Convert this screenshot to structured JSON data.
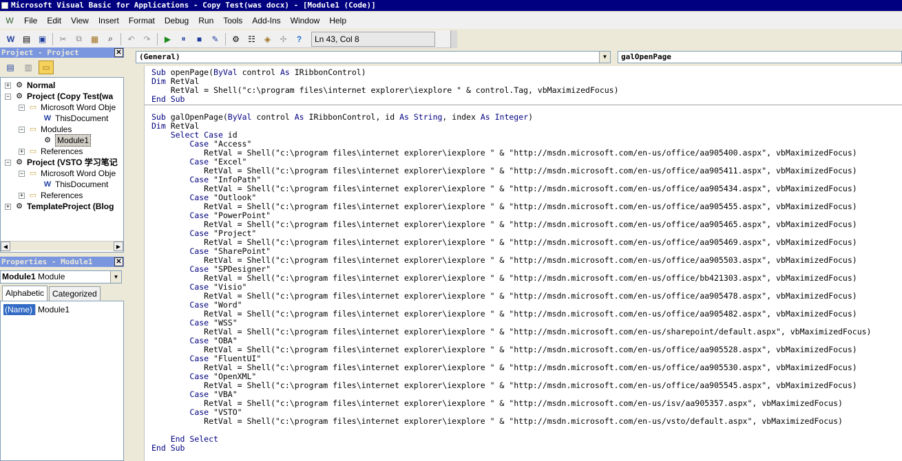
{
  "window": {
    "title": "Microsoft Visual Basic for Applications - Copy Test(was docx) - [Module1 (Code)]"
  },
  "menu": {
    "items": [
      "File",
      "Edit",
      "View",
      "Insert",
      "Format",
      "Debug",
      "Run",
      "Tools",
      "Add-Ins",
      "Window",
      "Help"
    ]
  },
  "toolbar": {
    "status": "Ln 43, Col 8"
  },
  "project_panel": {
    "title": "Project - Project",
    "close": "✕",
    "tree": [
      {
        "label": "Normal",
        "bold": true
      },
      {
        "label": "Project (Copy Test(wa",
        "bold": true
      },
      {
        "label": "Microsoft Word Obje"
      },
      {
        "label": "ThisDocument"
      },
      {
        "label": "Modules"
      },
      {
        "label": "Module1",
        "selected": true
      },
      {
        "label": "References"
      },
      {
        "label": "Project (VSTO 学习笔记",
        "bold": true
      },
      {
        "label": "Microsoft Word Obje"
      },
      {
        "label": "ThisDocument"
      },
      {
        "label": "References"
      },
      {
        "label": "TemplateProject (Blog",
        "bold": true
      }
    ]
  },
  "properties_panel": {
    "title": "Properties - Module1",
    "close": "✕",
    "object_name": "Module1",
    "object_type": "Module",
    "tabs": [
      "Alphabetic",
      "Categorized"
    ],
    "rows": [
      {
        "name": "(Name)",
        "value": "Module1"
      }
    ]
  },
  "code_window": {
    "object_combo": "(General)",
    "procedure_combo": "galOpenPage",
    "proc1": "Sub openPage(ByVal control As IRibbonControl)\nDim RetVal\n    RetVal = Shell(\"c:\\program files\\internet explorer\\iexplore \" & control.Tag, vbMaximizedFocus)\nEnd Sub",
    "proc2": "Sub galOpenPage(ByVal control As IRibbonControl, id As String, index As Integer)\nDim RetVal\n    Select Case id\n        Case \"Access\"\n           RetVal = Shell(\"c:\\program files\\internet explorer\\iexplore \" & \"http://msdn.microsoft.com/en-us/office/aa905400.aspx\", vbMaximizedFocus)\n        Case \"Excel\"\n           RetVal = Shell(\"c:\\program files\\internet explorer\\iexplore \" & \"http://msdn.microsoft.com/en-us/office/aa905411.aspx\", vbMaximizedFocus)\n        Case \"InfoPath\"\n           RetVal = Shell(\"c:\\program files\\internet explorer\\iexplore \" & \"http://msdn.microsoft.com/en-us/office/aa905434.aspx\", vbMaximizedFocus)\n        Case \"Outlook\"\n           RetVal = Shell(\"c:\\program files\\internet explorer\\iexplore \" & \"http://msdn.microsoft.com/en-us/office/aa905455.aspx\", vbMaximizedFocus)\n        Case \"PowerPoint\"\n           RetVal = Shell(\"c:\\program files\\internet explorer\\iexplore \" & \"http://msdn.microsoft.com/en-us/office/aa905465.aspx\", vbMaximizedFocus)\n        Case \"Project\"\n           RetVal = Shell(\"c:\\program files\\internet explorer\\iexplore \" & \"http://msdn.microsoft.com/en-us/office/aa905469.aspx\", vbMaximizedFocus)\n        Case \"SharePoint\"\n           RetVal = Shell(\"c:\\program files\\internet explorer\\iexplore \" & \"http://msdn.microsoft.com/en-us/office/aa905503.aspx\", vbMaximizedFocus)\n        Case \"SPDesigner\"\n           RetVal = Shell(\"c:\\program files\\internet explorer\\iexplore \" & \"http://msdn.microsoft.com/en-us/office/bb421303.aspx\", vbMaximizedFocus)\n        Case \"Visio\"\n           RetVal = Shell(\"c:\\program files\\internet explorer\\iexplore \" & \"http://msdn.microsoft.com/en-us/office/aa905478.aspx\", vbMaximizedFocus)\n        Case \"Word\"\n           RetVal = Shell(\"c:\\program files\\internet explorer\\iexplore \" & \"http://msdn.microsoft.com/en-us/office/aa905482.aspx\", vbMaximizedFocus)\n        Case \"WSS\"\n           RetVal = Shell(\"c:\\program files\\internet explorer\\iexplore \" & \"http://msdn.microsoft.com/en-us/sharepoint/default.aspx\", vbMaximizedFocus)\n        Case \"OBA\"\n           RetVal = Shell(\"c:\\program files\\internet explorer\\iexplore \" & \"http://msdn.microsoft.com/en-us/office/aa905528.aspx\", vbMaximizedFocus)\n        Case \"FluentUI\"\n           RetVal = Shell(\"c:\\program files\\internet explorer\\iexplore \" & \"http://msdn.microsoft.com/en-us/office/aa905530.aspx\", vbMaximizedFocus)\n        Case \"OpenXML\"\n           RetVal = Shell(\"c:\\program files\\internet explorer\\iexplore \" & \"http://msdn.microsoft.com/en-us/office/aa905545.aspx\", vbMaximizedFocus)\n        Case \"VBA\"\n           RetVal = Shell(\"c:\\program files\\internet explorer\\iexplore \" & \"http://msdn.microsoft.com/en-us/isv/aa905357.aspx\", vbMaximizedFocus)\n        Case \"VSTO\"\n           RetVal = Shell(\"c:\\program files\\internet explorer\\iexplore \" & \"http://msdn.microsoft.com/en-us/vsto/default.aspx\", vbMaximizedFocus)\n\n    End Select\nEnd Sub"
  },
  "colors": {
    "keyword": "#000080",
    "titlebar": "#000080",
    "panel_title": "#7a96df"
  }
}
